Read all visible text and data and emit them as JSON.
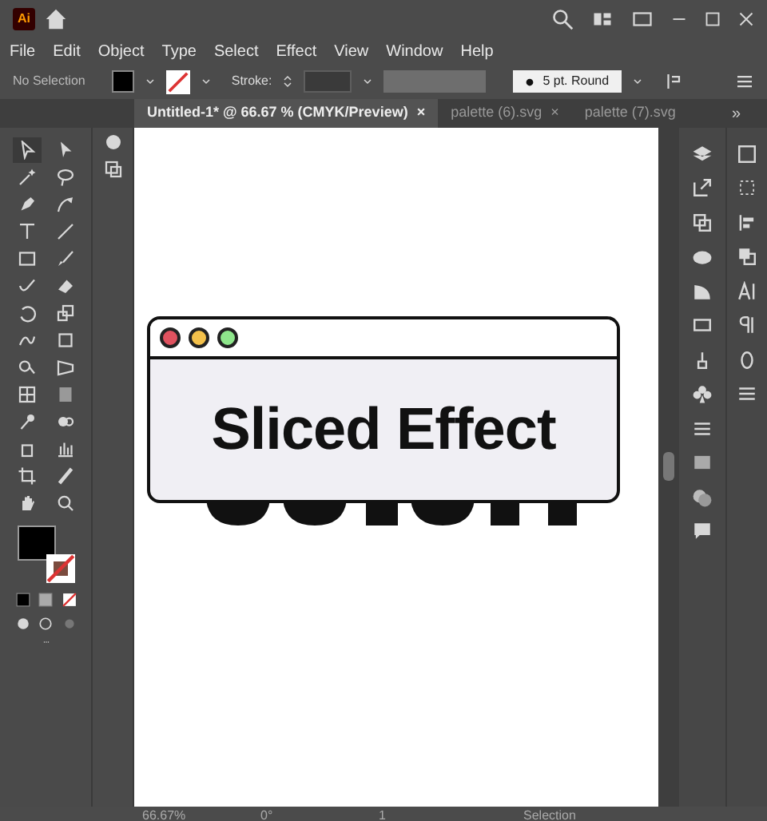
{
  "app_badge": "Ai",
  "menu": [
    "File",
    "Edit",
    "Object",
    "Type",
    "Select",
    "Effect",
    "View",
    "Window",
    "Help"
  ],
  "control_bar": {
    "selection": "No Selection",
    "stroke_label": "Stroke:",
    "brush": "5 pt. Round"
  },
  "tabs": [
    {
      "label": "Untitled-1* @ 66.67 % (CMYK/Preview)",
      "selected": true,
      "close": "×"
    },
    {
      "label": "palette (6).svg",
      "selected": false,
      "close": "×"
    },
    {
      "label": "palette (7).svg",
      "selected": false
    }
  ],
  "tab_overflow": "»",
  "artboard": {
    "heading": "Sliced Effect",
    "dots": [
      {
        "color": "#e0525f"
      },
      {
        "color": "#f4c14b"
      },
      {
        "color": "#8ee68b"
      }
    ]
  },
  "status_bar": {
    "zoom": "66.67%",
    "rotation": "0°",
    "artboard": "1",
    "tool": "Selection"
  }
}
